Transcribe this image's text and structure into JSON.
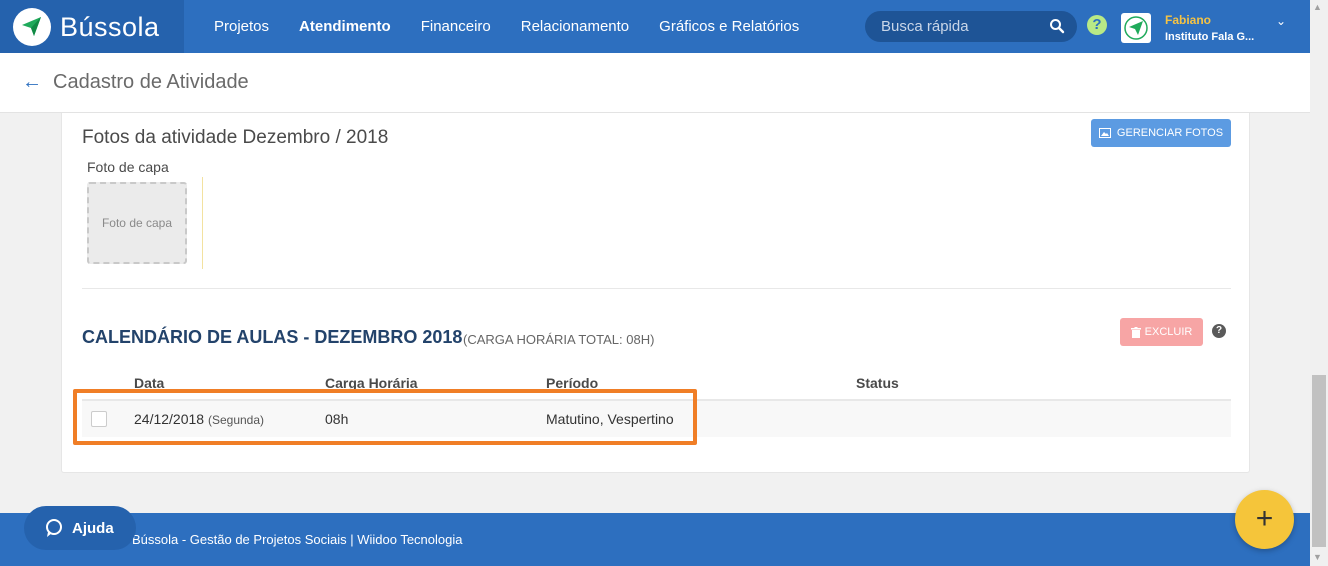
{
  "app": {
    "name": "Bússola"
  },
  "nav": {
    "items": [
      {
        "label": "Projetos"
      },
      {
        "label": "Atendimento"
      },
      {
        "label": "Financeiro"
      },
      {
        "label": "Relacionamento"
      },
      {
        "label": "Gráficos e Relatórios"
      }
    ],
    "active": "Atendimento"
  },
  "search": {
    "placeholder": "Busca rápida"
  },
  "user": {
    "name": "Fabiano",
    "org": "Instituto Fala G..."
  },
  "page": {
    "title": "Cadastro de Atividade"
  },
  "photos": {
    "title": "Fotos da atividade Dezembro / 2018",
    "manage_button": "GERENCIAR FOTOS",
    "cover_label": "Foto de capa",
    "cover_placeholder": "Foto de capa"
  },
  "calendar": {
    "title": "CALENDÁRIO DE AULAS - DEZEMBRO 2018",
    "subtitle": "(CARGA HORÁRIA TOTAL: 08H)",
    "delete_button": "EXCLUIR",
    "columns": [
      "Data",
      "Carga Horária",
      "Período",
      "Status"
    ],
    "rows": [
      {
        "date": "24/12/2018",
        "weekday": "(Segunda)",
        "hours": "08h",
        "period": "Matutino, Vespertino",
        "status": ""
      }
    ]
  },
  "footer": {
    "text": "Bússola - Gestão de Projetos Sociais  |  Wiidoo Tecnologia"
  },
  "help_button": {
    "label": "Ajuda"
  },
  "fab": {
    "label": "+"
  },
  "colors": {
    "primary": "#2d6fbf",
    "accent": "#f5c53a",
    "highlight": "#f07e26",
    "danger": "#f7a5a5"
  }
}
